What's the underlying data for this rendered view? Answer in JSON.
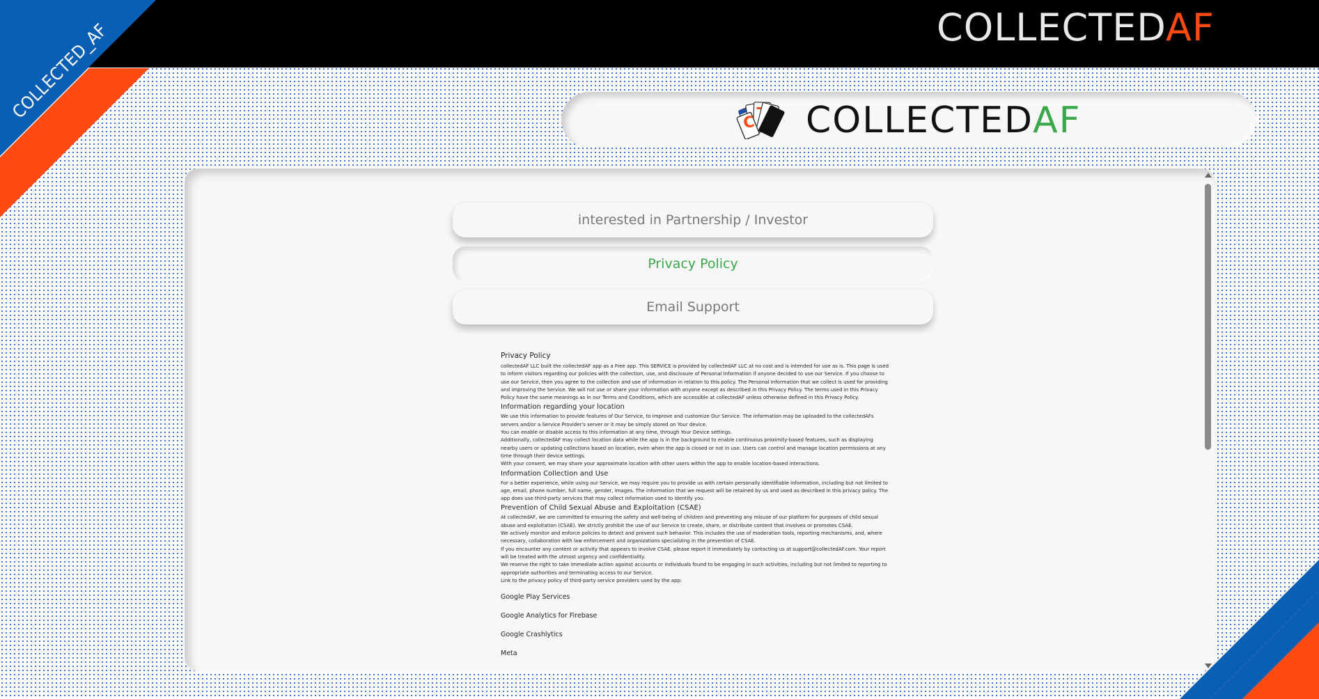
{
  "brand": {
    "header_part1": "COLLECTED",
    "header_part2": "AF",
    "corner_text": "COLLECTED_AF",
    "logo_part1": "COLLECTED",
    "logo_part2": "AF",
    "card_letter": "C"
  },
  "colors": {
    "orange_accent": "#ff4b12",
    "blue_accent": "#0a5fb4",
    "green_accent": "#3aa84a"
  },
  "menu": {
    "partnership": "interested in Partnership / Investor",
    "privacy": "Privacy Policy",
    "email": "Email Support",
    "active": "privacy"
  },
  "policy": {
    "title": "Privacy Policy",
    "intro": "collectedAF LLC built the collectedAF app as a Free app. This SERVICE is provided by collectedAF LLC at no cost and is intended for use as is. This page is used to inform visitors regarding our policies with the collection, use, and disclosure of Personal Information if anyone decided to use our Service. If you choose to use our Service, then you agree to the collection and use of information in relation to this policy. The Personal Information that we collect is used for providing and improving the Service. We will not use or share your information with anyone except as described in this Privacy Policy. The terms used in this Privacy Policy have the same meanings as in our Terms and Conditions, which are accessible at collectedAF unless otherwise defined in this Privacy Policy.",
    "location_heading": "Information regarding your location",
    "location_p1": "We use this information to provide features of Our Service, to improve and customize Our Service. The information may be uploaded to the collectedAFs servers and/or a Service Provider's server or it may be simply stored on Your device.",
    "location_p2": "You can enable or disable access to this information at any time, through Your Device settings.",
    "location_p3": "Additionally, collectedAF may collect location data while the app is in the background to enable continuous proximity-based features, such as displaying nearby users or updating collections based on location, even when the app is closed or not in use. Users can control and manage location permissions at any time through their device settings.",
    "location_p4": "With your consent, we may share your approximate location with other users within the app to enable location-based interactions.",
    "collection_heading": "Information Collection and Use",
    "collection_p1": "For a better experience, while using our Service, we may require you to provide us with certain personally identifiable information, including but not limited to age, email, phone number, full name, gender, images. The information that we request will be retained by us and used as described in this privacy policy. The app does use third-party services that may collect information used to identify you.",
    "csae_heading": "Prevention of Child Sexual Abuse and Exploitation (CSAE)",
    "csae_p1": "At collectedAF, we are committed to ensuring the safety and well-being of children and preventing any misuse of our platform for purposes of child sexual abuse and exploitation (CSAE). We strictly prohibit the use of our Service to create, share, or distribute content that involves or promotes CSAE.",
    "csae_p2": "We actively monitor and enforce policies to detect and prevent such behavior. This includes the use of moderation tools, reporting mechanisms, and, where necessary, collaboration with law enforcement and organizations specializing in the prevention of CSAE.",
    "csae_p3": "If you encounter any content or activity that appears to involve CSAE, please report it immediately by contacting us at support@collectedAF.com. Your report will be treated with the utmost urgency and confidentiality.",
    "csae_p4": "We reserve the right to take immediate action against accounts or individuals found to be engaging in such activities, including but not limited to reporting to appropriate authorities and terminating access to our Service.",
    "third_party_intro": "Link to the privacy policy of third-party service providers used by the app:",
    "providers": [
      "Google Play Services",
      "Google Analytics for Firebase",
      "Google Crashlytics",
      "Meta"
    ]
  }
}
